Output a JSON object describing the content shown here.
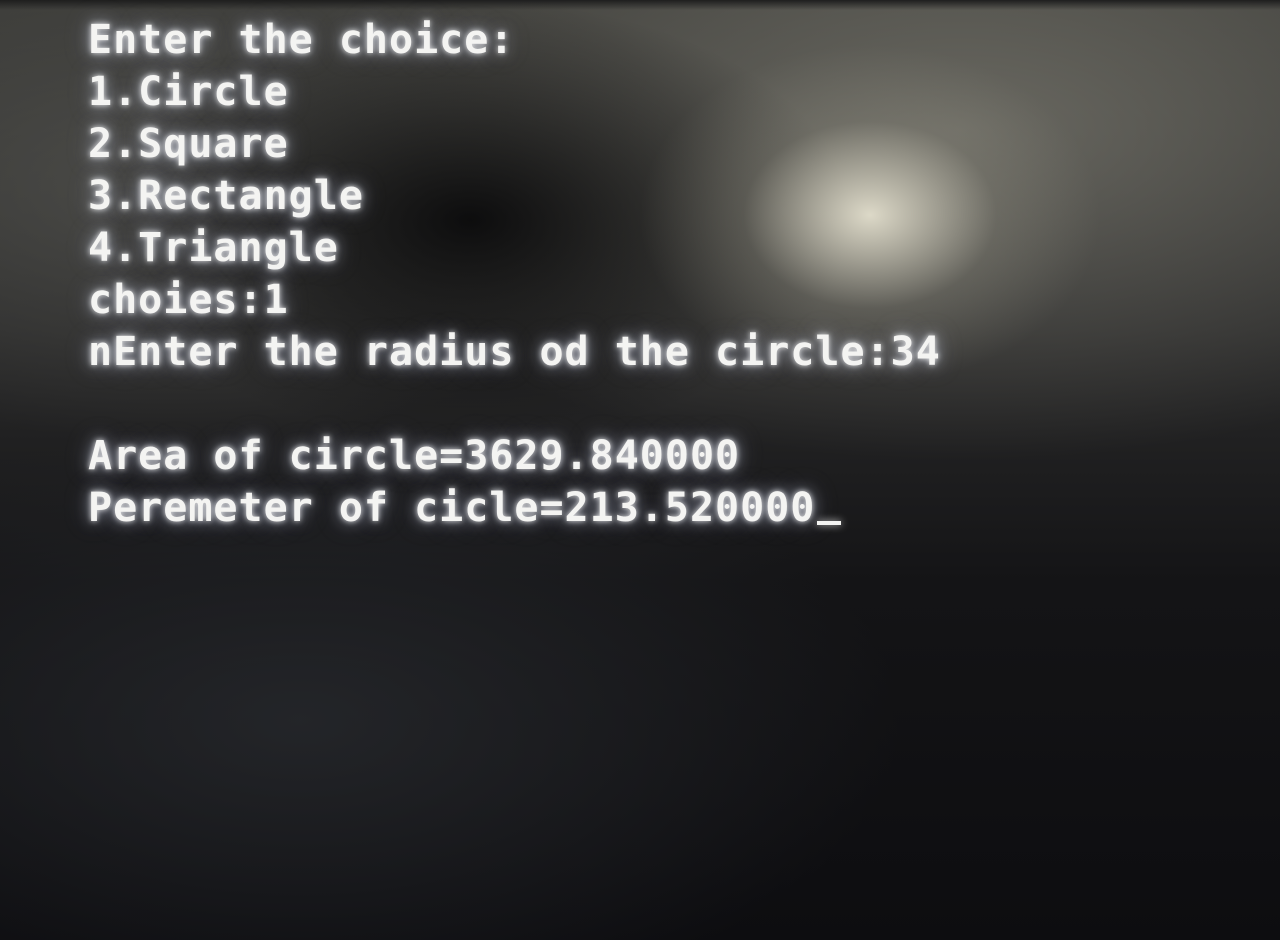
{
  "terminal": {
    "lines": [
      "Enter the choice:",
      "1.Circle",
      "2.Square",
      "3.Rectangle",
      "4.Triangle",
      "choies:1",
      "nEnter the radius od the circle:34",
      "",
      "Area of circle=3629.840000",
      "Peremeter of cicle=213.520000"
    ],
    "cursor": "_"
  }
}
